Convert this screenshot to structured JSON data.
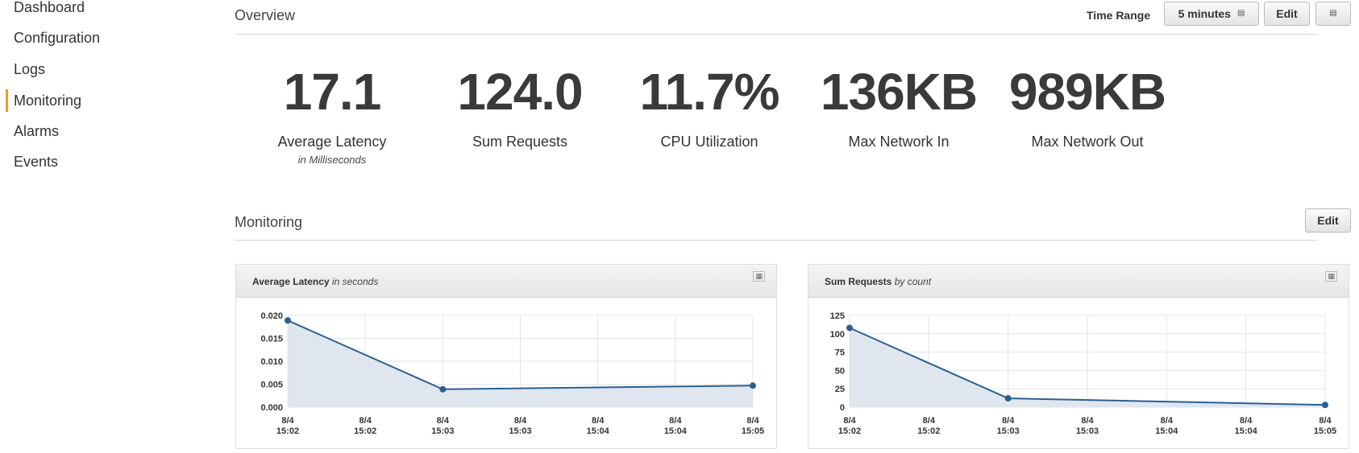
{
  "sidebar": {
    "items": [
      {
        "label": "Dashboard"
      },
      {
        "label": "Configuration"
      },
      {
        "label": "Logs"
      },
      {
        "label": "Monitoring",
        "active": true
      },
      {
        "label": "Alarms"
      },
      {
        "label": "Events"
      }
    ],
    "active_color": "#f29b1d"
  },
  "overview": {
    "title": "Overview",
    "time_range_label": "Time Range",
    "time_range_value": "5 minutes",
    "edit_label": "Edit",
    "metrics": [
      {
        "value": "17.1",
        "label": "Average Latency",
        "sublabel": "in Milliseconds"
      },
      {
        "value": "124.0",
        "label": "Sum Requests"
      },
      {
        "value": "11.7%",
        "label": "CPU Utilization"
      },
      {
        "value": "136KB",
        "label": "Max Network In"
      },
      {
        "value": "989KB",
        "label": "Max Network Out"
      }
    ]
  },
  "monitoring": {
    "title": "Monitoring",
    "edit_label": "Edit"
  },
  "chart_data": [
    {
      "type": "area",
      "title": "Average Latency",
      "unit_label": "in seconds",
      "x": [
        "8/4 15:02",
        "8/4 15:02",
        "8/4 15:03",
        "8/4 15:03",
        "8/4 15:04",
        "8/4 15:04",
        "8/4 15:05"
      ],
      "x_ticks": [
        [
          "8/4",
          "15:02"
        ],
        [
          "8/4",
          "15:02"
        ],
        [
          "8/4",
          "15:03"
        ],
        [
          "8/4",
          "15:03"
        ],
        [
          "8/4",
          "15:04"
        ],
        [
          "8/4",
          "15:04"
        ],
        [
          "8/4",
          "15:05"
        ]
      ],
      "y_ticks": [
        "0.000",
        "0.005",
        "0.010",
        "0.015",
        "0.020"
      ],
      "ylim": [
        0,
        0.02
      ],
      "points": [
        {
          "x_index": 0,
          "y": 0.0189
        },
        {
          "x_index": 2,
          "y": 0.0039
        },
        {
          "x_index": 6,
          "y": 0.0047
        }
      ],
      "color": "#2e5f8e"
    },
    {
      "type": "area",
      "title": "Sum Requests",
      "unit_label": "by count",
      "x": [
        "8/4 15:02",
        "8/4 15:02",
        "8/4 15:03",
        "8/4 15:03",
        "8/4 15:04",
        "8/4 15:04",
        "8/4 15:05"
      ],
      "x_ticks": [
        [
          "8/4",
          "15:02"
        ],
        [
          "8/4",
          "15:02"
        ],
        [
          "8/4",
          "15:03"
        ],
        [
          "8/4",
          "15:03"
        ],
        [
          "8/4",
          "15:04"
        ],
        [
          "8/4",
          "15:04"
        ],
        [
          "8/4",
          "15:05"
        ]
      ],
      "y_ticks": [
        "0",
        "25",
        "50",
        "75",
        "100",
        "125"
      ],
      "ylim": [
        0,
        125
      ],
      "points": [
        {
          "x_index": 0,
          "y": 108
        },
        {
          "x_index": 2,
          "y": 12
        },
        {
          "x_index": 6,
          "y": 3
        }
      ],
      "color": "#2e5f8e"
    }
  ]
}
